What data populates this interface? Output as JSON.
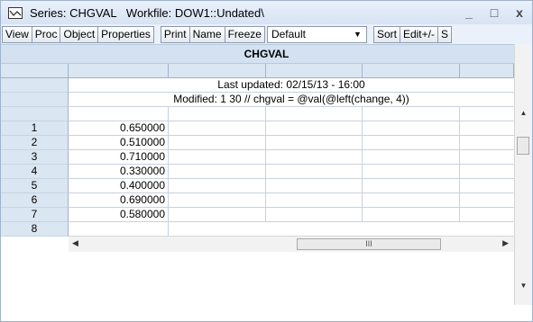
{
  "window": {
    "title": "Series: CHGVAL   Workfile: DOW1::Undated\\",
    "minimize": "_",
    "maximize": "□",
    "close": "x",
    "icon": "series-chart-icon"
  },
  "toolbar": {
    "buttons": [
      "View",
      "Proc",
      "Object",
      "Properties",
      "Print",
      "Name",
      "Freeze",
      "Sort",
      "Edit+/-",
      "S"
    ],
    "dropdown_value": "Default"
  },
  "sheet": {
    "series_name": "CHGVAL",
    "last_updated": "Last updated: 02/15/13 - 16:00",
    "modified": "Modified: 1 30 // chgval = @val(@left(change, 4))",
    "rows": [
      {
        "index": "1",
        "value": "0.650000"
      },
      {
        "index": "2",
        "value": "0.510000"
      },
      {
        "index": "3",
        "value": "0.710000"
      },
      {
        "index": "4",
        "value": "0.330000"
      },
      {
        "index": "5",
        "value": "0.400000"
      },
      {
        "index": "6",
        "value": "0.690000"
      },
      {
        "index": "7",
        "value": "0.580000"
      },
      {
        "index": "8",
        "value": ""
      }
    ]
  },
  "scrollbar": {
    "h_thumb_grip": "III"
  }
}
